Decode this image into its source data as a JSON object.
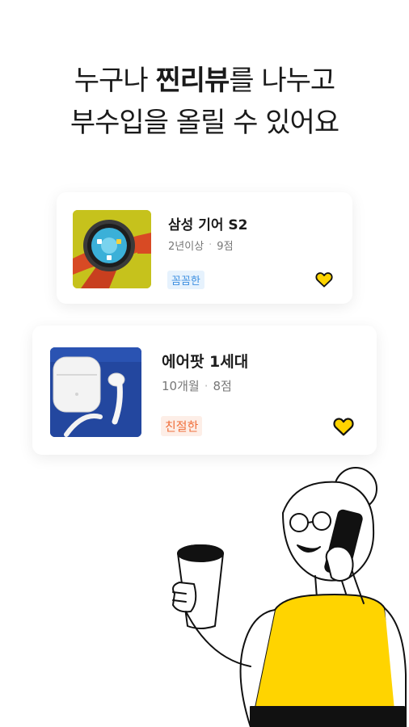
{
  "headline": {
    "line1_before": "누구나 ",
    "line1_strong": "찐리뷰",
    "line1_after": "를 나누고",
    "line2": "부수입을 올릴 수 있어요"
  },
  "cards": [
    {
      "title": "삼성 기어 S2",
      "period": "2년이상",
      "score": "9점",
      "tag": "꼼꼼한",
      "image": "smartwatch-photo",
      "heart_icon": "heart-icon",
      "tag_color": "#3d8fe0"
    },
    {
      "title": "에어팟 1세대",
      "period": "10개월",
      "score": "8점",
      "tag": "친절한",
      "image": "airpods-photo",
      "heart_icon": "heart-icon",
      "tag_color": "#f0703c"
    }
  ],
  "colors": {
    "accent": "#ffd400",
    "heart": "#ffd400"
  }
}
